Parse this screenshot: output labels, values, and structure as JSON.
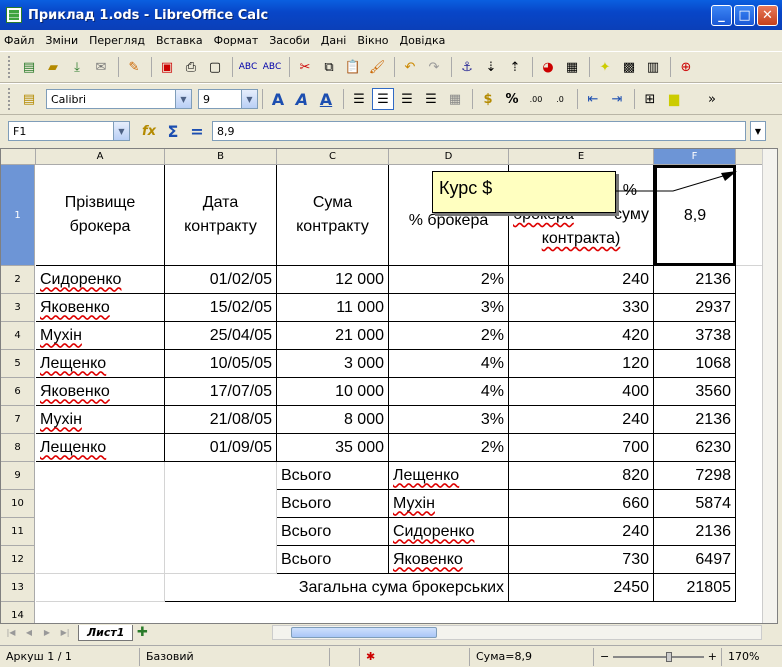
{
  "window": {
    "title": "Приклад  1.ods - LibreOffice Calc",
    "minimize": "_",
    "maximize": "□",
    "close": "✕"
  },
  "menu": [
    "Файл",
    "Зміни",
    "Перегляд",
    "Вставка",
    "Формат",
    "Засоби",
    "Дані",
    "Вікно",
    "Довідка"
  ],
  "format_toolbar": {
    "font": "Calibri",
    "size": "9",
    "percent": "%"
  },
  "formula_bar": {
    "cell_ref": "F1",
    "value": "8,9",
    "func_icon": "fx",
    "sum_icon": "Σ",
    "equals": "="
  },
  "columns": [
    "A",
    "B",
    "C",
    "D",
    "E",
    "F"
  ],
  "rows": [
    "1",
    "2",
    "3",
    "4",
    "5",
    "6",
    "7",
    "8",
    "9",
    "10",
    "11",
    "12",
    "13",
    "14"
  ],
  "header": {
    "a": "Прізвище брокера",
    "b": "Дата контракту",
    "c": "Сума контракту",
    "d": "% брокера",
    "e_1": "%",
    "e_2": "брокера",
    "e_3": "суму",
    "e_4": "контракта)",
    "f": "8,9"
  },
  "data": [
    {
      "name": "Сидоренко",
      "date": "01/02/05",
      "sum": "12 000",
      "pct": "2%",
      "e": "240",
      "f": "2136"
    },
    {
      "name": "Яковенко",
      "date": "15/02/05",
      "sum": "11 000",
      "pct": "3%",
      "e": "330",
      "f": "2937"
    },
    {
      "name": "Мухін",
      "date": "25/04/05",
      "sum": "21 000",
      "pct": "2%",
      "e": "420",
      "f": "3738"
    },
    {
      "name": "Лещенко",
      "date": "10/05/05",
      "sum": "3 000",
      "pct": "4%",
      "e": "120",
      "f": "1068"
    },
    {
      "name": "Яковенко",
      "date": "17/07/05",
      "sum": "10 000",
      "pct": "4%",
      "e": "400",
      "f": "3560"
    },
    {
      "name": "Мухін",
      "date": "21/08/05",
      "sum": "8 000",
      "pct": "3%",
      "e": "240",
      "f": "2136"
    },
    {
      "name": "Лещенко",
      "date": "01/09/05",
      "sum": "35 000",
      "pct": "2%",
      "e": "700",
      "f": "6230"
    }
  ],
  "totals": [
    {
      "label": "Всього",
      "name": "Лещенко",
      "e": "820",
      "f": "7298"
    },
    {
      "label": "Всього",
      "name": "Мухін",
      "e": "660",
      "f": "5874"
    },
    {
      "label": "Всього",
      "name": "Сидоренко",
      "e": "240",
      "f": "2136"
    },
    {
      "label": "Всього",
      "name": "Яковенко",
      "e": "730",
      "f": "6497"
    }
  ],
  "grand": {
    "label": "Загальна сума брокерських",
    "e": "2450",
    "f": "21805"
  },
  "comment": "Курс $",
  "tabs": {
    "sheet": "Лист1"
  },
  "status": {
    "sheet": "Аркуш 1 / 1",
    "style": "Базовий",
    "sum": "Сума=8,9",
    "zoom": "170%"
  }
}
